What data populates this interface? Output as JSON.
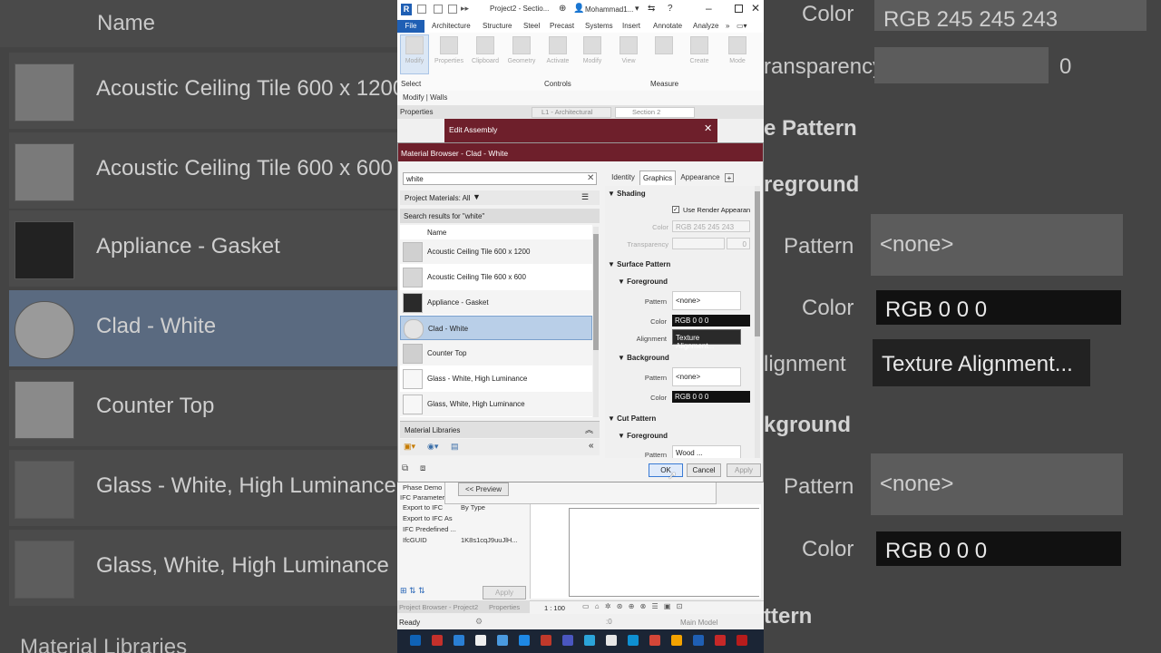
{
  "background_left": {
    "header": "Name",
    "rows": [
      {
        "label": "Acoustic Ceiling Tile 600 x 1200"
      },
      {
        "label": "Acoustic Ceiling Tile 600 x 600"
      },
      {
        "label": "Appliance - Gasket"
      },
      {
        "label": "Clad - White"
      },
      {
        "label": "Counter Top"
      },
      {
        "label": "Glass - White, High Luminance"
      },
      {
        "label": "Glass, White, High Luminance"
      }
    ],
    "footer": "Material Libraries"
  },
  "background_right": {
    "color_label": "Color",
    "color_value": "RGB 245 245 243",
    "transparency_label": "ransparency",
    "transparency_value": "0",
    "surface_pattern": "e Pattern",
    "foreground": "reground",
    "pattern_label": "Pattern",
    "pattern_value": "<none>",
    "color2_label": "Color",
    "color2_value": "RGB 0 0 0",
    "alignment_label": "lignment",
    "alignment_value": "Texture Alignment...",
    "background": "kground",
    "pattern3_label": "Pattern",
    "pattern3_value": "<none>",
    "color3_label": "Color",
    "color3_value": "RGB 0 0 0",
    "cut_pattern": "ttern"
  },
  "titlebar": {
    "title": "Project2 - Sectio...",
    "user": "Mohammad1...",
    "app_icon": "R"
  },
  "ribbon": {
    "tabs": [
      "File",
      "Architecture",
      "Structure",
      "Steel",
      "Precast",
      "Systems",
      "Insert",
      "Annotate",
      "Analyze"
    ],
    "buttons": [
      "Modify",
      "Properties",
      "Clipboard",
      "Geometry",
      "Activate",
      "Modify",
      "View",
      "Measure",
      "Create",
      "Mode"
    ],
    "panels": [
      "Select",
      "Controls",
      "Measure"
    ],
    "context": "Modify | Walls"
  },
  "view_tabs": {
    "properties": "Properties",
    "tab1": "L1 - Architectural",
    "tab2": "Section 2"
  },
  "edit_assembly": {
    "title": "Edit Assembly"
  },
  "material_browser": {
    "title": "Material Browser - Clad - White",
    "search_value": "white",
    "filter_label": "Project Materials: All",
    "results_label": "Search results for \"white\"",
    "list_header": "Name",
    "items": [
      {
        "label": "Acoustic Ceiling Tile 600 x 1200"
      },
      {
        "label": "Acoustic Ceiling Tile 600 x 600"
      },
      {
        "label": "Appliance - Gasket"
      },
      {
        "label": "Clad - White"
      },
      {
        "label": "Counter Top"
      },
      {
        "label": "Glass - White, High Luminance"
      },
      {
        "label": "Glass, White, High Luminance"
      }
    ],
    "libraries_label": "Material Libraries",
    "tabs": [
      "Identity",
      "Graphics",
      "Appearance"
    ],
    "graphics": {
      "shading": "Shading",
      "use_render": "Use Render Appearan",
      "color_label": "Color",
      "color_value": "RGB 245 245 243",
      "transparency_label": "Transparency",
      "transparency_value": "0",
      "surface_pattern": "Surface Pattern",
      "foreground": "Foreground",
      "pattern_label": "Pattern",
      "pattern_value": "<none>",
      "fg_color_label": "Color",
      "fg_color_value": "RGB 0 0 0",
      "alignment_label": "Alignment",
      "alignment_value": "Texture Alignment...",
      "background": "Background",
      "bg_pattern_label": "Pattern",
      "bg_pattern_value": "<none>",
      "bg_color_label": "Color",
      "bg_color_value": "RGB 0 0 0",
      "cut_pattern": "Cut Pattern",
      "cut_foreground": "Foreground",
      "cut_pattern_label": "Pattern",
      "cut_pattern_value": "Wood ..."
    },
    "ok": "OK",
    "cancel": "Cancel",
    "apply": "Apply"
  },
  "lower": {
    "preview_btn": "<< Preview",
    "props": [
      {
        "k": "Phase Demo",
        "v": ""
      },
      {
        "k": "IFC Parameter",
        "v": ""
      },
      {
        "k": "Export to IFC",
        "v": "By Type"
      },
      {
        "k": "Export to IFC As",
        "v": ""
      },
      {
        "k": "IFC Predefined ...",
        "v": ""
      },
      {
        "k": "IfcGUID",
        "v": "1K8s1cqJ9uuJlH..."
      }
    ],
    "apply": "Apply",
    "project_browser": "Project Browser - Project2",
    "properties_tab": "Properties",
    "scale": "1 : 100"
  },
  "status": {
    "text": "Ready",
    "zero": ":0",
    "model": "Main Model"
  },
  "colors": {
    "dialog_title": "#6e1f2b",
    "selection": "#b9cfe8",
    "revit_blue": "#1f5fb4"
  }
}
